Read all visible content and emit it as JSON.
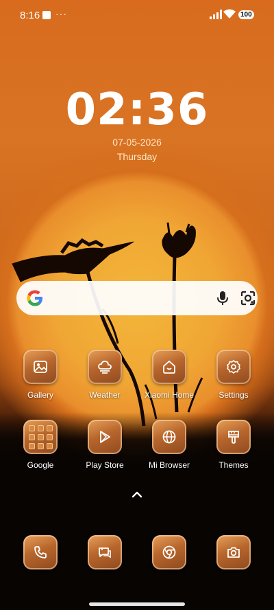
{
  "status_bar": {
    "time": "8:16",
    "more": "···",
    "battery": "100"
  },
  "lock_clock": {
    "time": "02:36",
    "date": "07-05-2026",
    "day": "Thursday"
  },
  "search_bar": {
    "logo": "google-g-icon",
    "voice_icon": "mic-icon",
    "lens_icon": "lens-icon"
  },
  "apps_row1": [
    {
      "label": "Gallery",
      "icon": "gallery-icon"
    },
    {
      "label": "Weather",
      "icon": "weather-icon"
    },
    {
      "label": "Xiaomi Home",
      "icon": "home-icon"
    },
    {
      "label": "Settings",
      "icon": "gear-icon"
    }
  ],
  "apps_row2": [
    {
      "label": "Google",
      "icon": "folder-icon"
    },
    {
      "label": "Play Store",
      "icon": "play-store-icon"
    },
    {
      "label": "Mi Browser",
      "icon": "globe-icon"
    },
    {
      "label": "Themes",
      "icon": "brush-icon"
    }
  ],
  "dock": [
    {
      "icon": "phone-icon"
    },
    {
      "icon": "messages-icon"
    },
    {
      "icon": "chrome-icon"
    },
    {
      "icon": "camera-icon"
    }
  ],
  "theme": {
    "tile_color": "#b8662c",
    "accent": "#f0a634"
  }
}
